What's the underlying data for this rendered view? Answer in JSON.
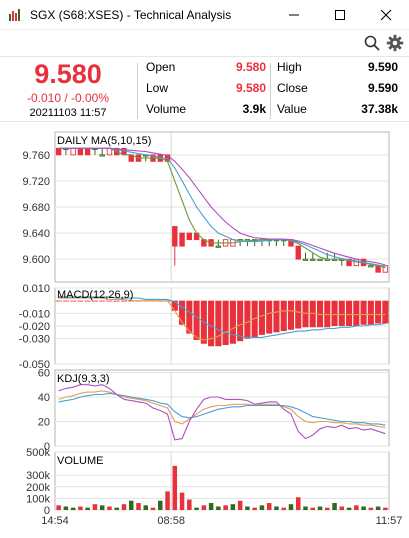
{
  "window": {
    "title": "SGX (S68:XSES) - Technical Analysis",
    "minimize_label": "Minimize",
    "maximize_label": "Maximize",
    "close_label": "Close"
  },
  "toolbar": {
    "search_icon": "search-icon",
    "settings_icon": "gear-icon"
  },
  "quote": {
    "price": "9.580",
    "change": "-0.010 / -0.00%",
    "timestamp": "20211103 11:57",
    "fields": [
      {
        "label": "Open",
        "value": "9.580",
        "color": "red"
      },
      {
        "label": "High",
        "value": "9.590",
        "color": "black"
      },
      {
        "label": "Low",
        "value": "9.580",
        "color": "red"
      },
      {
        "label": "Close",
        "value": "9.590",
        "color": "black"
      },
      {
        "label": "Volume",
        "value": "3.9k",
        "color": "black"
      },
      {
        "label": "Value",
        "value": "37.38k",
        "color": "black"
      }
    ]
  },
  "colors": {
    "up": "#e8313a",
    "down": "#2f6b1e",
    "ma5": "#6f9a3e",
    "ma10": "#4a9fd1",
    "ma15": "#b04fc0",
    "k": "#e0a050",
    "d": "#4a9fd1",
    "j": "#b04fc0"
  },
  "x_axis": {
    "labels": [
      "14:54",
      "08:58",
      "11:57"
    ]
  },
  "panels": {
    "price": {
      "label": "DAILY MA(5,10,15)",
      "ticks": [
        "9.760",
        "9.720",
        "9.680",
        "9.640",
        "9.600"
      ],
      "tick_values": [
        9.76,
        9.72,
        9.68,
        9.64,
        9.6
      ],
      "range": [
        9.565,
        9.795
      ]
    },
    "macd": {
      "label": "MACD(12,26,9)",
      "ticks": [
        "0.010",
        "-0.010",
        "-0.020",
        "-0.030",
        "-0.050"
      ],
      "tick_values": [
        0.01,
        -0.01,
        -0.02,
        -0.03,
        -0.05
      ],
      "range": [
        -0.05,
        0.01
      ]
    },
    "kdj": {
      "label": "KDJ(9,3,3)",
      "ticks": [
        "60",
        "40",
        "20",
        "0"
      ],
      "tick_values": [
        60,
        40,
        20,
        0
      ],
      "range": [
        0,
        62
      ]
    },
    "volume": {
      "label": "VOLUME",
      "ticks": [
        "500k",
        "300k",
        "200k",
        "100k",
        "0"
      ],
      "tick_values": [
        500000,
        300000,
        200000,
        100000,
        0
      ],
      "range": [
        0,
        500000
      ]
    }
  },
  "chart_data": [
    {
      "type": "candlestick",
      "title": "DAILY MA(5,10,15)",
      "ylim": [
        9.565,
        9.795
      ],
      "candles": [
        [
          9.77,
          9.77,
          9.76,
          9.76
        ],
        [
          9.77,
          9.77,
          9.76,
          9.77
        ],
        [
          9.76,
          9.77,
          9.76,
          9.77
        ],
        [
          9.77,
          9.77,
          9.76,
          9.76
        ],
        [
          9.77,
          9.77,
          9.76,
          9.76
        ],
        [
          9.77,
          9.77,
          9.76,
          9.77
        ],
        [
          9.76,
          9.77,
          9.76,
          9.76
        ],
        [
          9.76,
          9.77,
          9.76,
          9.77
        ],
        [
          9.77,
          9.77,
          9.76,
          9.76
        ],
        [
          9.77,
          9.77,
          9.76,
          9.76
        ],
        [
          9.76,
          9.76,
          9.75,
          9.75
        ],
        [
          9.76,
          9.76,
          9.75,
          9.75
        ],
        [
          9.76,
          9.76,
          9.75,
          9.76
        ],
        [
          9.76,
          9.76,
          9.75,
          9.75
        ],
        [
          9.76,
          9.76,
          9.75,
          9.75
        ],
        [
          9.76,
          9.76,
          9.75,
          9.75
        ],
        [
          9.65,
          9.65,
          9.59,
          9.62
        ],
        [
          9.64,
          9.64,
          9.62,
          9.62
        ],
        [
          9.64,
          9.64,
          9.63,
          9.63
        ],
        [
          9.64,
          9.64,
          9.63,
          9.63
        ],
        [
          9.63,
          9.63,
          9.62,
          9.62
        ],
        [
          9.63,
          9.63,
          9.62,
          9.62
        ],
        [
          9.62,
          9.63,
          9.62,
          9.62
        ],
        [
          9.62,
          9.63,
          9.62,
          9.63
        ],
        [
          9.62,
          9.63,
          9.62,
          9.63
        ],
        [
          9.63,
          9.63,
          9.62,
          9.63
        ],
        [
          9.63,
          9.63,
          9.62,
          9.63
        ],
        [
          9.63,
          9.63,
          9.62,
          9.63
        ],
        [
          9.63,
          9.63,
          9.62,
          9.63
        ],
        [
          9.63,
          9.63,
          9.62,
          9.63
        ],
        [
          9.63,
          9.63,
          9.62,
          9.63
        ],
        [
          9.63,
          9.63,
          9.62,
          9.63
        ],
        [
          9.63,
          9.63,
          9.62,
          9.62
        ],
        [
          9.62,
          9.62,
          9.6,
          9.6
        ],
        [
          9.6,
          9.61,
          9.6,
          9.6
        ],
        [
          9.6,
          9.61,
          9.6,
          9.6
        ],
        [
          9.6,
          9.6,
          9.6,
          9.6
        ],
        [
          9.6,
          9.61,
          9.6,
          9.6
        ],
        [
          9.6,
          9.61,
          9.6,
          9.6
        ],
        [
          9.6,
          9.6,
          9.59,
          9.6
        ],
        [
          9.6,
          9.6,
          9.59,
          9.59
        ],
        [
          9.59,
          9.6,
          9.59,
          9.6
        ],
        [
          9.6,
          9.6,
          9.59,
          9.59
        ],
        [
          9.59,
          9.59,
          9.59,
          9.59
        ],
        [
          9.59,
          9.59,
          9.58,
          9.58
        ],
        [
          9.58,
          9.59,
          9.58,
          9.59
        ]
      ],
      "ma5": [
        9.77,
        9.77,
        9.77,
        9.77,
        9.77,
        9.77,
        9.77,
        9.77,
        9.765,
        9.76,
        9.76,
        9.755,
        9.755,
        9.755,
        9.755,
        9.75,
        9.72,
        9.69,
        9.66,
        9.64,
        9.63,
        9.625,
        9.625,
        9.625,
        9.625,
        9.627,
        9.628,
        9.629,
        9.63,
        9.63,
        9.63,
        9.63,
        9.628,
        9.624,
        9.617,
        9.61,
        9.603,
        9.6,
        9.6,
        9.6,
        9.598,
        9.596,
        9.594,
        9.592,
        9.59,
        9.587
      ],
      "ma10": [
        9.77,
        9.77,
        9.77,
        9.77,
        9.77,
        9.77,
        9.77,
        9.77,
        9.768,
        9.766,
        9.764,
        9.762,
        9.76,
        9.758,
        9.756,
        9.754,
        9.74,
        9.72,
        9.7,
        9.68,
        9.665,
        9.65,
        9.64,
        9.635,
        9.63,
        9.628,
        9.627,
        9.627,
        9.628,
        9.629,
        9.63,
        9.63,
        9.629,
        9.626,
        9.622,
        9.617,
        9.612,
        9.607,
        9.604,
        9.601,
        9.599,
        9.597,
        9.595,
        9.593,
        9.591,
        9.589
      ],
      "ma15": [
        9.77,
        9.77,
        9.77,
        9.77,
        9.77,
        9.77,
        9.77,
        9.77,
        9.769,
        9.768,
        9.767,
        9.766,
        9.765,
        9.763,
        9.761,
        9.759,
        9.75,
        9.738,
        9.725,
        9.71,
        9.695,
        9.68,
        9.668,
        9.657,
        9.648,
        9.64,
        9.636,
        9.633,
        9.632,
        9.631,
        9.631,
        9.631,
        9.63,
        9.628,
        9.625,
        9.621,
        9.617,
        9.613,
        9.609,
        9.606,
        9.603,
        9.6,
        9.598,
        9.596,
        9.594,
        9.591
      ]
    },
    {
      "type": "bar",
      "title": "MACD(12,26,9)",
      "ylim": [
        -0.05,
        0.01
      ],
      "histogram": [
        0.0,
        0.0,
        0.0,
        0.0,
        0.0,
        0.0,
        0.0,
        0.0,
        0.0,
        0.0,
        0.0,
        0.0,
        0.0,
        0.0,
        0.0,
        0.0,
        -0.008,
        -0.019,
        -0.026,
        -0.031,
        -0.034,
        -0.036,
        -0.036,
        -0.035,
        -0.034,
        -0.032,
        -0.03,
        -0.029,
        -0.027,
        -0.026,
        -0.025,
        -0.024,
        -0.023,
        -0.022,
        -0.021,
        -0.021,
        -0.021,
        -0.021,
        -0.02,
        -0.02,
        -0.02,
        -0.02,
        -0.019,
        -0.019,
        -0.018,
        -0.018
      ],
      "dif": [
        0.002,
        0.002,
        0.002,
        0.002,
        0.002,
        0.002,
        0.002,
        0.001,
        0.001,
        0.001,
        0.0,
        0.0,
        0.0,
        0.0,
        0.0,
        0.0,
        -0.008,
        -0.017,
        -0.024,
        -0.029,
        -0.031,
        -0.03,
        -0.028,
        -0.025,
        -0.022,
        -0.019,
        -0.017,
        -0.014,
        -0.012,
        -0.01,
        -0.009,
        -0.008,
        -0.008,
        -0.009,
        -0.01,
        -0.01,
        -0.011,
        -0.011,
        -0.011,
        -0.011,
        -0.011,
        -0.011,
        -0.011,
        -0.011,
        -0.011,
        -0.011
      ],
      "dea": [
        0.003,
        0.003,
        0.003,
        0.003,
        0.003,
        0.003,
        0.003,
        0.003,
        0.002,
        0.002,
        0.002,
        0.002,
        0.001,
        0.001,
        0.001,
        0.001,
        -0.001,
        -0.005,
        -0.009,
        -0.013,
        -0.017,
        -0.02,
        -0.023,
        -0.025,
        -0.027,
        -0.028,
        -0.029,
        -0.029,
        -0.029,
        -0.028,
        -0.027,
        -0.026,
        -0.025,
        -0.024,
        -0.024,
        -0.023,
        -0.023,
        -0.022,
        -0.022,
        -0.021,
        -0.021,
        -0.02,
        -0.02,
        -0.019,
        -0.019,
        -0.018
      ]
    },
    {
      "type": "line",
      "title": "KDJ(9,3,3)",
      "ylim": [
        0,
        62
      ],
      "k": [
        38,
        40,
        41,
        43,
        44,
        44,
        45,
        44,
        42,
        40,
        39,
        38,
        37,
        35,
        33,
        31,
        20,
        18,
        22,
        26,
        30,
        32,
        33,
        33,
        34,
        34,
        34,
        33,
        34,
        34,
        34,
        32,
        30,
        24,
        20,
        19,
        20,
        20,
        19,
        19,
        18,
        18,
        17,
        17,
        16,
        15
      ],
      "d": [
        36,
        37,
        38,
        40,
        41,
        42,
        42,
        43,
        42,
        41,
        40,
        39,
        38,
        37,
        35,
        34,
        28,
        24,
        23,
        24,
        26,
        28,
        30,
        31,
        32,
        32,
        33,
        33,
        33,
        33,
        33,
        33,
        32,
        30,
        27,
        24,
        23,
        22,
        21,
        20,
        20,
        19,
        19,
        18,
        18,
        17
      ],
      "j": [
        45,
        47,
        48,
        50,
        50,
        49,
        50,
        47,
        42,
        38,
        37,
        36,
        35,
        31,
        29,
        26,
        5,
        6,
        20,
        30,
        38,
        40,
        40,
        38,
        38,
        38,
        37,
        34,
        35,
        36,
        36,
        30,
        26,
        12,
        6,
        9,
        14,
        16,
        15,
        17,
        14,
        15,
        13,
        14,
        12,
        10
      ]
    },
    {
      "type": "bar",
      "title": "VOLUME",
      "ylim": [
        0,
        500000
      ],
      "values": [
        40000,
        30000,
        20000,
        30000,
        20000,
        50000,
        40000,
        30000,
        20000,
        50000,
        80000,
        60000,
        40000,
        20000,
        80000,
        160000,
        380000,
        150000,
        90000,
        20000,
        40000,
        60000,
        30000,
        40000,
        50000,
        80000,
        30000,
        20000,
        40000,
        60000,
        30000,
        20000,
        50000,
        110000,
        30000,
        20000,
        30000,
        20000,
        60000,
        30000,
        20000,
        40000,
        30000,
        20000,
        30000,
        20000
      ],
      "directions": [
        "up",
        "down",
        "down",
        "up",
        "down",
        "up",
        "down",
        "up",
        "down",
        "up",
        "down",
        "up",
        "down",
        "up",
        "down",
        "up",
        "up",
        "up",
        "up",
        "down",
        "up",
        "down",
        "down",
        "up",
        "down",
        "up",
        "down",
        "up",
        "down",
        "up",
        "down",
        "up",
        "down",
        "up",
        "down",
        "up",
        "down",
        "up",
        "down",
        "up",
        "down",
        "up",
        "down",
        "up",
        "down",
        "up"
      ]
    }
  ]
}
